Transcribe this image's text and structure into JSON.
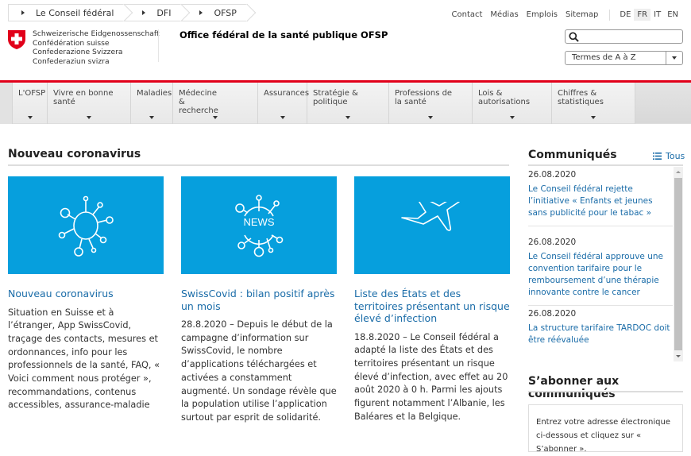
{
  "breadcrumb": [
    "Le Conseil fédéral",
    "DFI",
    "OFSP"
  ],
  "top_links": [
    "Contact",
    "Médias",
    "Emplois",
    "Sitemap"
  ],
  "languages": [
    "DE",
    "FR",
    "IT",
    "EN"
  ],
  "active_language": "FR",
  "logo_lines": [
    "Schweizerische Eidgenossenschaft",
    "Confédération suisse",
    "Confederazione Svizzera",
    "Confederaziun svizra"
  ],
  "office_title": "Office fédéral de la santé publique OFSP",
  "search": {
    "placeholder": ""
  },
  "terms_select": "Termes de A à Z",
  "nav": [
    "L'OFSP",
    "Vivre en bonne santé",
    "Maladies",
    "Médecine & recherche",
    "Assurances",
    "Stratégie & politique",
    "Professions de la santé",
    "Lois & autorisations",
    "Chiffres & statistiques"
  ],
  "main": {
    "heading": "Nouveau coronavirus",
    "cards": [
      {
        "title": "Nouveau coronavirus",
        "body": "Situation en Suisse et à l’étranger, App SwissCovid, traçage des contacts, mesures et ordonnances, info pour les professionnels de la santé, FAQ, « Voici comment nous protéger », recommandations, contenus accessibles, assurance-maladie",
        "icon": "virus-icon"
      },
      {
        "title": "SwissCovid : bilan positif après un mois",
        "body": "28.8.2020 – Depuis le début de la campagne d’information sur SwissCovid, le nombre d’applications téléchargées et activées a constamment augmenté. Un sondage révèle que la population utilise l’application surtout par esprit de solidarité.",
        "icon": "news-icon",
        "icon_text": "NEWS"
      },
      {
        "title": "Liste des États et des territoires présentant un risque élevé d’infection",
        "body": "18.8.2020 – Le Conseil fédéral a adapté la liste des États et des territoires présentant un risque élevé d’infection, avec effet au 20 août 2020 à 0 h. Parmi les ajouts figurent notamment l’Albanie, les Baléares et la Belgique.",
        "icon": "airplane-icon"
      }
    ]
  },
  "communiques": {
    "heading": "Communiqués",
    "all_label": "Tous",
    "items": [
      {
        "date": "26.08.2020",
        "title": "Le Conseil fédéral rejette l’initiative « Enfants et jeunes sans publicité pour le tabac »"
      },
      {
        "date": "26.08.2020",
        "title": "Le Conseil fédéral approuve une convention tarifaire pour le remboursement d’une thérapie innovante contre le cancer"
      },
      {
        "date": "26.08.2020",
        "title": "La structure tarifaire TARDOC doit être réévaluée"
      }
    ]
  },
  "subscribe": {
    "heading": "S’abonner aux communiqués",
    "text": "Entrez votre adresse électronique ci-dessous et cliquez sur « S’abonner »."
  },
  "colors": {
    "brand_red": "#e1001a",
    "tile_blue": "#069fdd",
    "link": "#1a6ca8"
  }
}
